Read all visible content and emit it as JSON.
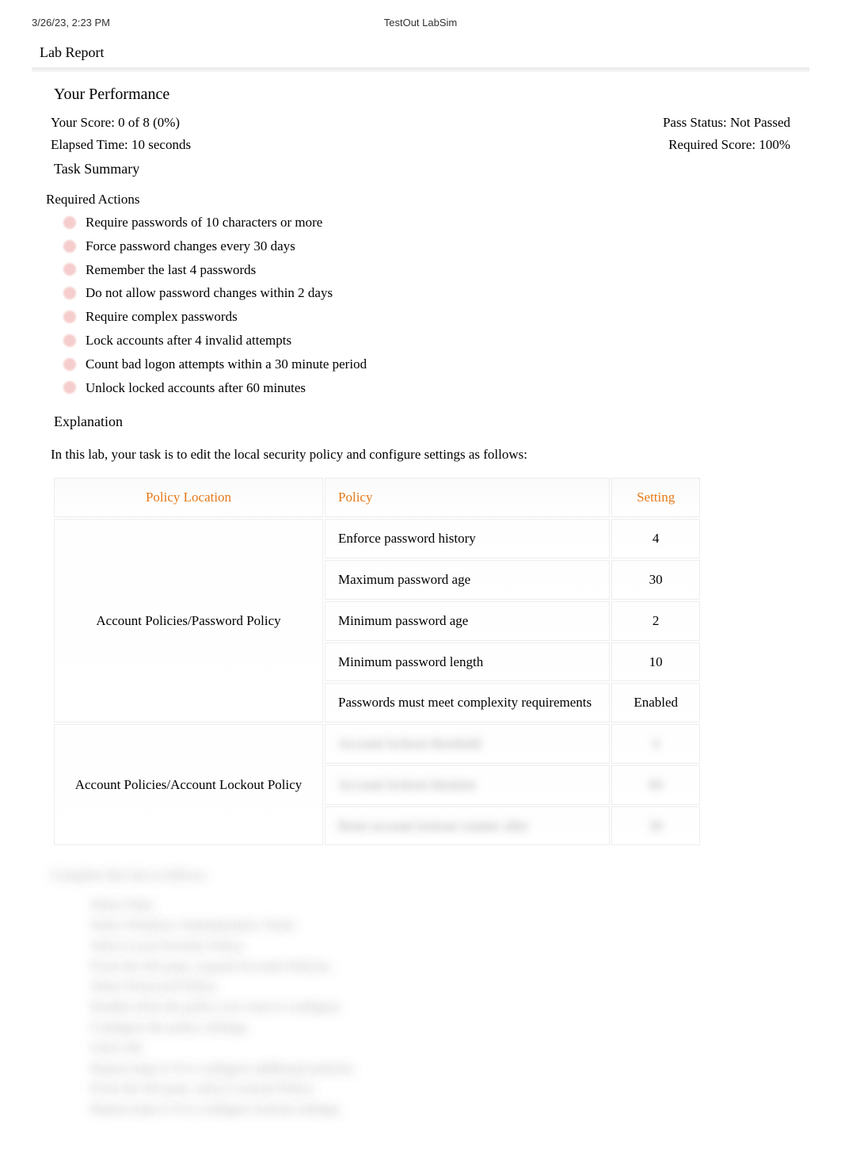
{
  "header": {
    "timestamp": "3/26/23, 2:23 PM",
    "appname": "TestOut LabSim"
  },
  "report": {
    "title": "Lab Report",
    "perf_heading": "Your Performance",
    "score_line": "Your Score: 0 of 8 (0%)",
    "elapsed_line": "Elapsed Time: 10 seconds",
    "pass_line": "Pass Status: Not Passed",
    "required_line": "Required Score: 100%"
  },
  "task": {
    "heading": "Task Summary",
    "required_label": "Required Actions"
  },
  "actions": [
    "Require passwords of 10 characters or more",
    "Force password changes every 30 days",
    "Remember the last 4 passwords",
    "Do not allow password changes within 2 days",
    "Require complex passwords",
    "Lock accounts after 4 invalid attempts",
    "Count bad logon attempts within a 30 minute period",
    "Unlock locked accounts after 60 minutes"
  ],
  "explanation": {
    "heading": "Explanation",
    "intro": "In this lab, your task is to edit the local security policy and configure settings as follows:"
  },
  "table": {
    "headers": {
      "loc": "Policy Location",
      "pol": "Policy",
      "set": "Setting"
    },
    "groups": [
      {
        "location": "Account Policies/Password Policy",
        "rows": [
          {
            "policy": "Enforce password history",
            "setting": "4"
          },
          {
            "policy": "Maximum password age",
            "setting": "30"
          },
          {
            "policy": "Minimum password age",
            "setting": "2"
          },
          {
            "policy": "Minimum password length",
            "setting": "10"
          },
          {
            "policy": "Passwords must meet complexity requirements",
            "setting": "Enabled"
          }
        ]
      },
      {
        "location": "Account Policies/Account Lockout Policy",
        "rows": [
          {
            "policy": "Account lockout threshold",
            "setting": "4"
          },
          {
            "policy": "Account lockout duration",
            "setting": "60"
          },
          {
            "policy": "Reset account lockout counter after",
            "setting": "30"
          }
        ]
      }
    ]
  },
  "instructions": {
    "lead": "Complete this lab as follows:",
    "steps": [
      "Select Start.",
      "Select Windows Administrative Tools.",
      "Select Local Security Policy.",
      "From the left pane, expand Account Policies.",
      "Select Password Policy.",
      "Double-click the policy you want to configure.",
      "Configure the policy settings.",
      "Click OK.",
      "Repeat steps 6–8 to configure additional policies.",
      "From the left pane, select Lockout Policy.",
      "Repeat steps 6–8 to configure lockout settings."
    ]
  }
}
